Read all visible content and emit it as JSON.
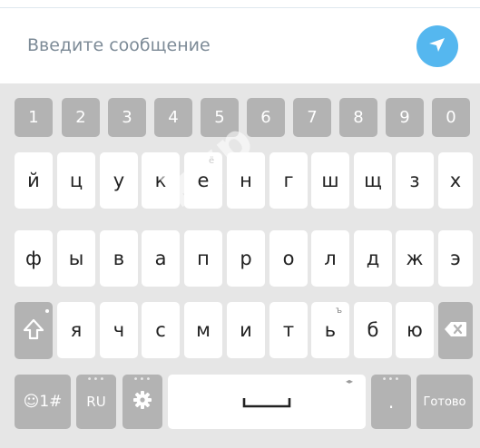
{
  "composer": {
    "placeholder": "Введите сообщение",
    "send_icon": "send-arrow-icon",
    "accent": "#55b7ef"
  },
  "watermark": "kyp",
  "keyboard": {
    "number_row": [
      "1",
      "2",
      "3",
      "4",
      "5",
      "6",
      "7",
      "8",
      "9",
      "0"
    ],
    "row1": [
      "й",
      "ц",
      "у",
      "к",
      "е",
      "н",
      "г",
      "ш",
      "щ",
      "з",
      "х"
    ],
    "row1_hint_e": "ё",
    "row2": [
      "ф",
      "ы",
      "в",
      "а",
      "п",
      "р",
      "о",
      "л",
      "д",
      "ж",
      "э"
    ],
    "row3": [
      "я",
      "ч",
      "с",
      "м",
      "и",
      "т",
      "ь",
      "б",
      "ю"
    ],
    "row3_hint_soft": "ъ",
    "emoji_label": "☺1#",
    "language_label": "RU",
    "period_label": ".",
    "done_label": "Готово",
    "shift_icon": "shift-arrow-icon",
    "backspace_icon": "backspace-icon",
    "settings_icon": "gear-icon",
    "space_icon": "spacebar-icon",
    "key_color": "#ffffff",
    "function_key_color": "#b3b3b3",
    "background_color": "#e6e6e6"
  }
}
